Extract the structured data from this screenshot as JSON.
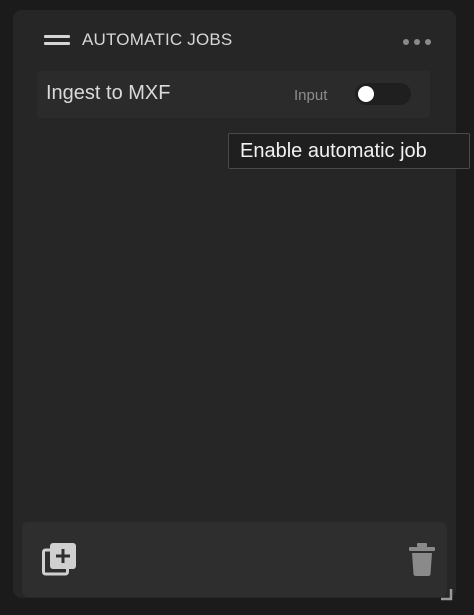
{
  "panel": {
    "title": "AUTOMATIC JOBS",
    "icons": {
      "drag": "drag-handle-icon",
      "more": "more-options-icon",
      "add": "add-job-icon",
      "delete": "trash-icon",
      "resize": "resize-handle-icon"
    }
  },
  "jobs": [
    {
      "name": "Ingest to MXF",
      "type": "Input",
      "enabled": false
    }
  ],
  "tooltip": {
    "text": "Enable automatic job"
  },
  "colors": {
    "background": "#1b1b1b",
    "panel": "#262626",
    "row": "#2b2b2b",
    "footer": "#2e2e2e",
    "text": "#dadada",
    "muted": "#8d8d8d",
    "toggle_off": "#1f1f1f",
    "toggle_knob": "#ffffff"
  }
}
